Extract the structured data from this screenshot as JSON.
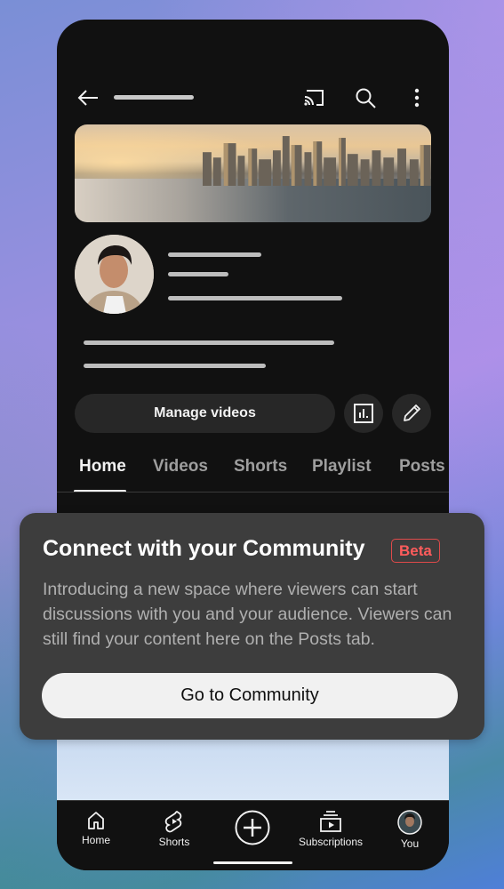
{
  "top_bar": {
    "icons": [
      "back-arrow-icon",
      "cast-icon",
      "search-icon",
      "more-vertical-icon"
    ]
  },
  "channel": {
    "banner": "city-skyline-banner",
    "avatar": "channel-avatar"
  },
  "actions": {
    "manage_videos_label": "Manage videos",
    "analytics_icon": "analytics-icon",
    "edit_icon": "pencil-icon"
  },
  "tabs": [
    {
      "label": "Home",
      "active": true
    },
    {
      "label": "Videos",
      "active": false
    },
    {
      "label": "Shorts",
      "active": false
    },
    {
      "label": "Playlist",
      "active": false
    },
    {
      "label": "Posts",
      "active": false
    }
  ],
  "popup": {
    "title": "Connect with your Community",
    "badge": "Beta",
    "body": "Introducing a new space where viewers can start discussions with you and your audience. Viewers can still find your content here on the Posts tab.",
    "cta_label": "Go to Community"
  },
  "bottom_nav": [
    {
      "label": "Home",
      "icon": "home-icon"
    },
    {
      "label": "Shorts",
      "icon": "shorts-icon"
    },
    {
      "label": "",
      "icon": "create-plus-icon"
    },
    {
      "label": "Subscriptions",
      "icon": "subscriptions-icon"
    },
    {
      "label": "You",
      "icon": "profile-avatar-icon"
    }
  ],
  "colors": {
    "surface": "#111111",
    "popup": "#3d3d3d",
    "badge_red": "#ff5c5c",
    "cta_bg": "#f1f1f1"
  }
}
